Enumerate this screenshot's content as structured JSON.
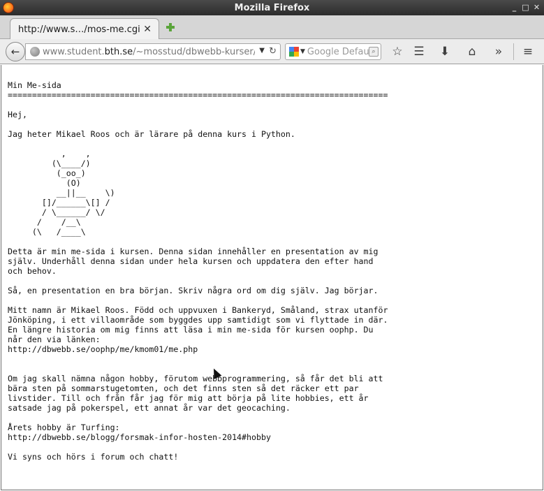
{
  "window": {
    "title": "Mozilla Firefox",
    "controls": {
      "minimize": "_",
      "maximize": "□",
      "close": "✕"
    }
  },
  "tabs": [
    {
      "label": "http://www.s…/mos-me.cgi",
      "close": "✕"
    }
  ],
  "navbar": {
    "url_prefix": "www.student.",
    "url_host": "bth.se",
    "url_suffix": "/~mosstud/dbwebb-kurser/p",
    "search_placeholder": "Google Defau",
    "icons": [
      "back-icon",
      "globe-icon",
      "dropdown-icon",
      "reload-icon",
      "google-icon",
      "magnifier-icon",
      "star-icon",
      "reader-icon",
      "download-icon",
      "home-icon",
      "overflow-icon",
      "menu-icon"
    ]
  },
  "page": {
    "text": "Min Me-sida\n==============================================================================\n\nHej,\n\nJag heter Mikael Roos och är lärare på denna kurs i Python.\n\n           ,    ,\n         (\\____/)\n          (_oo_)\n            (O)\n          __||__    \\)\n       []/______\\[] /\n       / \\______/ \\/\n      /    /__\\\n     (\\   /____\\\n\nDetta är min me-sida i kursen. Denna sidan innehåller en presentation av mig\nsjälv. Underhåll denna sidan under hela kursen och uppdatera den efter hand\noch behov.\n\nSå, en presentation en bra början. Skriv några ord om dig själv. Jag börjar.\n\nMitt namn är Mikael Roos. Född och uppvuxen i Bankeryd, Småland, strax utanför\nJönköping, i ett villaområde som byggdes upp samtidigt som vi flyttade in där.\nEn längre historia om mig finns att läsa i min me-sida för kursen oophp. Du\nnår den via länken:\nhttp://dbwebb.se/oophp/me/kmom01/me.php\n\n\nOm jag skall nämna någon hobby, förutom webbprogrammering, så får det bli att\nbära sten på sommarstugetomten, och det finns sten så det räcker ett par\nlivstider. Till och från får jag för mig att börja på lite hobbies, ett år\nsatsade jag på pokerspel, ett annat år var det geocaching.\n\nÅrets hobby är Turfing:\nhttp://dbwebb.se/blogg/forsmak-infor-hosten-2014#hobby\n\nVi syns och hörs i forum och chatt!"
  }
}
